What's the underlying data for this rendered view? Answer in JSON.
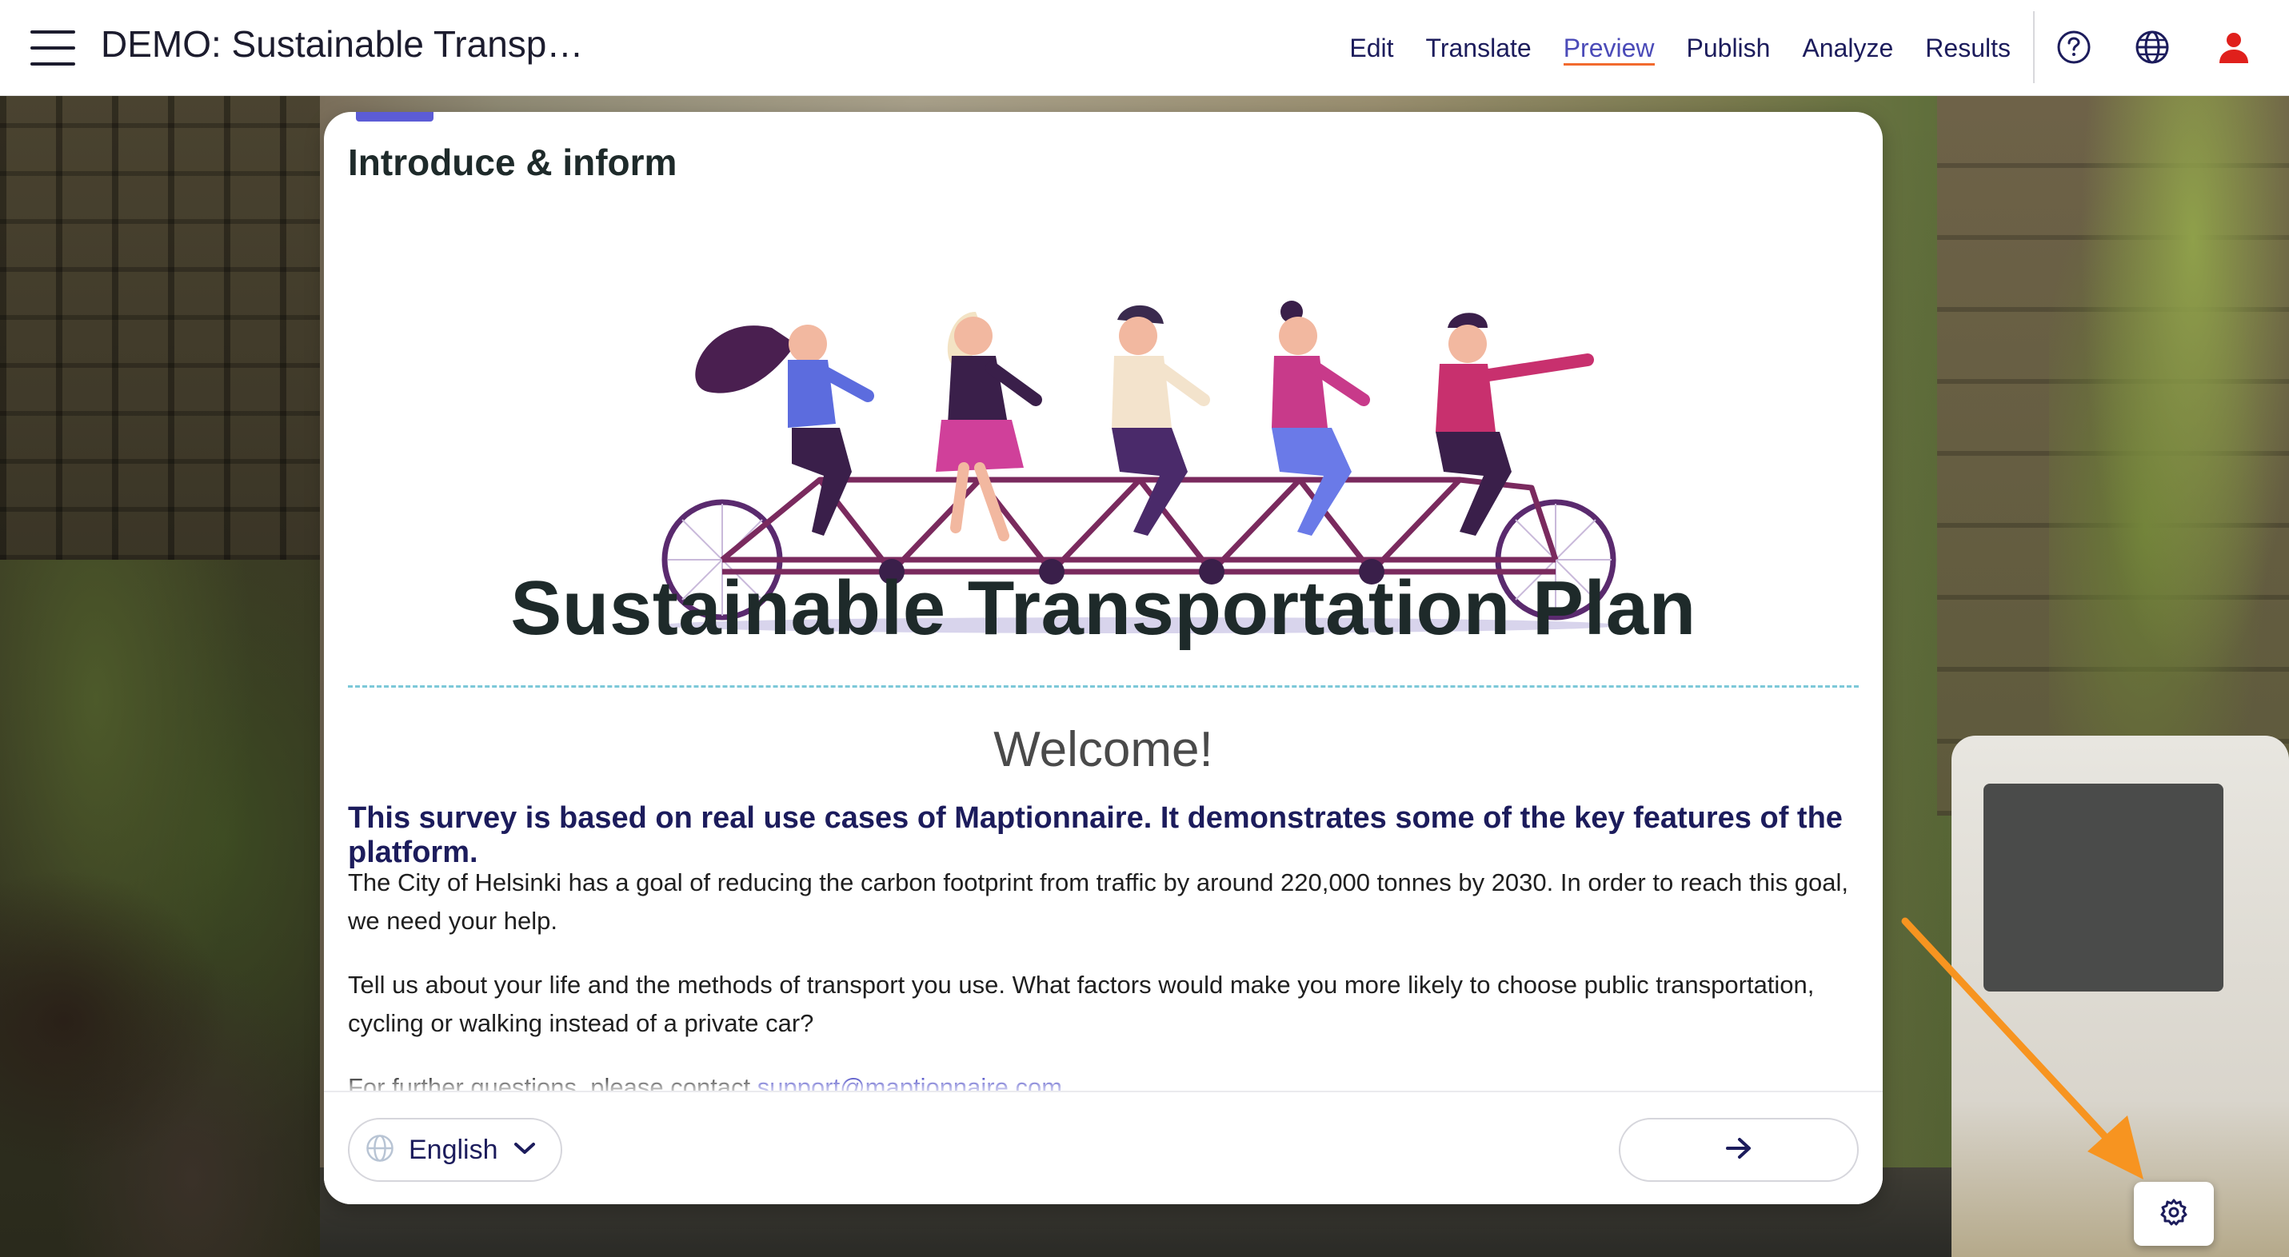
{
  "app": {
    "title": "DEMO: Sustainable Transp…"
  },
  "nav": {
    "items": [
      {
        "label": "Edit",
        "active": false
      },
      {
        "label": "Translate",
        "active": false
      },
      {
        "label": "Preview",
        "active": true
      },
      {
        "label": "Publish",
        "active": false
      },
      {
        "label": "Analyze",
        "active": false
      },
      {
        "label": "Results",
        "active": false
      }
    ],
    "icons": [
      "help-circle-icon",
      "globe-icon",
      "user-icon"
    ]
  },
  "survey": {
    "progress": 0.05,
    "section_title": "Introduce & inform",
    "main_title": "Sustainable Transportation Plan",
    "welcome": "Welcome!",
    "intro_bold": "This survey is based on real use cases of Maptionnaire. It demonstrates some of the key features of the platform.",
    "paragraph_1": "The City of Helsinki has a goal of reducing the carbon footprint from traffic by around 220,000 tonnes by 2030. In order to reach this goal, we need your help.",
    "paragraph_2": "Tell us about your life and the methods of transport you use. What factors would make you more likely to choose public transportation, cycling or walking instead of a private car?",
    "paragraph_3_prefix": "For further questions, please contact ",
    "contact_email": "support@maptionnaire.com"
  },
  "footer": {
    "language": "English",
    "next_icon": "arrow-right-icon"
  },
  "floating": {
    "settings_icon": "gear-icon",
    "annotation": "orange-arrow-icon"
  },
  "colors": {
    "accent": "#4b4bb8",
    "active_underline": "#f26a2e",
    "text_dark": "#1c1c5c",
    "user_icon": "#e0201c",
    "annotation": "#f79420",
    "divider": "#7cc8d8"
  }
}
